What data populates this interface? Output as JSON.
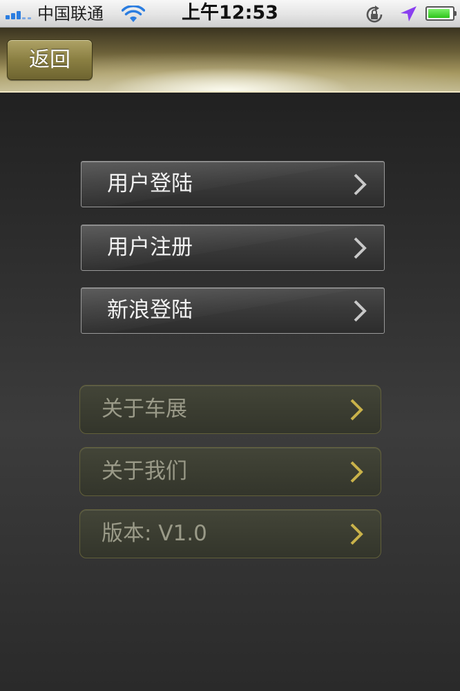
{
  "status_bar": {
    "carrier": "中国联通",
    "time": "上午12:53",
    "battery_level": 0.92,
    "icons": [
      "signal-icon",
      "wifi-icon",
      "rotation-lock-icon",
      "location-arrow-icon",
      "battery-icon"
    ]
  },
  "nav": {
    "back_label": "返回"
  },
  "menu": {
    "account_items": [
      {
        "label": "用户登陆"
      },
      {
        "label": "用户注册"
      },
      {
        "label": "新浪登陆"
      }
    ],
    "info_items": [
      {
        "label": "关于车展"
      },
      {
        "label": "关于我们"
      },
      {
        "label": "版本: V1.0"
      }
    ]
  },
  "colors": {
    "nav_gold": "#8a7f42",
    "olive_chevron": "#c9b24a",
    "silver_chevron": "#c8c8c8"
  }
}
